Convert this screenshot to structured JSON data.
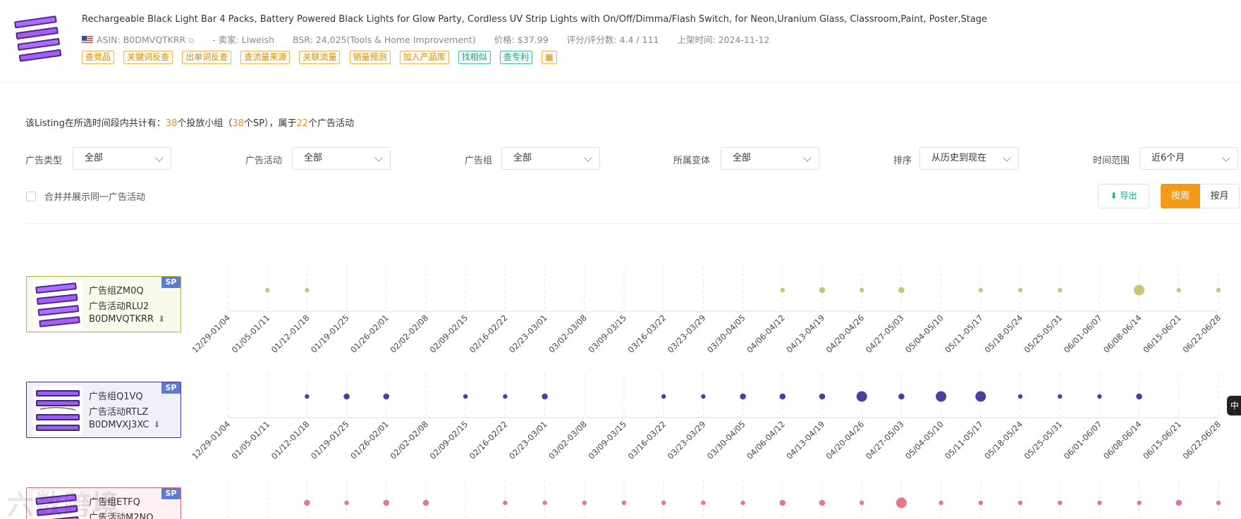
{
  "product": {
    "title": "Rechargeable Black Light Bar 4 Packs, Battery Powered Black Lights for Glow Party, Cordless UV Strip Lights with On/Off/Dimma/Flash Switch, for Neon,Uranium Glass, Classroom,Paint, Poster,Stage",
    "asin": "ASIN: B0DMVQTKRR",
    "seller": "- 卖家: Liweish",
    "bsr": "BSR: 24,025(Tools & Home Improvement)",
    "price": "价格: $37.99",
    "rating": "评分/评分数: 4.4 / 111",
    "listed": "上架时间: 2024-11-12",
    "tags": [
      "查竞品",
      "关键词反查",
      "出单词反查",
      "查流量来源",
      "关联流量",
      "销量预测",
      "加入产品库",
      "找相似",
      "查专利"
    ]
  },
  "summary": {
    "prefix": "该Listing在所选时间段内共计有：",
    "groups": "38",
    "mid1": "个投放小组（",
    "sp": "38",
    "mid2": "个SP），属于",
    "campaigns": "22",
    "suffix": "个广告活动"
  },
  "filters": {
    "ad_type": {
      "label": "广告类型",
      "value": "全部"
    },
    "campaign": {
      "label": "广告活动",
      "value": "全部"
    },
    "ad_group": {
      "label": "广告组",
      "value": "全部"
    },
    "variant": {
      "label": "所属变体",
      "value": "全部"
    },
    "sort": {
      "label": "排序",
      "value": "从历史到现在"
    },
    "time_range": {
      "label": "时间范围",
      "value": "近6个月"
    }
  },
  "merge_label": "合并并展示同一广告活动",
  "export_label": "导出",
  "granularity": {
    "week": "按周",
    "month": "按月"
  },
  "weeks": [
    "12/29-01/04",
    "01/05-01/11",
    "01/12-01/18",
    "01/19-01/25",
    "01/26-02/01",
    "02/02-02/08",
    "02/09-02/15",
    "02/16-02/22",
    "02/23-03/01",
    "03/02-03/08",
    "03/09-03/15",
    "03/16-03/22",
    "03/23-03/29",
    "03/30-04/05",
    "04/06-04/12",
    "04/13-04/19",
    "04/20-04/26",
    "04/27-05/03",
    "05/04-05/10",
    "05/11-05/17",
    "05/18-05/24",
    "05/25-05/31",
    "06/01-06/07",
    "06/08-06/14",
    "06/15-06/21",
    "06/22-06/28"
  ],
  "ad_groups": [
    {
      "group": "广告组ZM0Q",
      "campaign": "广告活动RLU2",
      "asin": "B0DMVQTKRR",
      "badge": "SP",
      "color": "#c5c774",
      "border": "#a8b452",
      "bg": "#f8faec",
      "dots": [
        0,
        1,
        1,
        0,
        0,
        0,
        0,
        0,
        0,
        0,
        0,
        0,
        0,
        0,
        1,
        2,
        1,
        2,
        0,
        1,
        1,
        1,
        0,
        3,
        1,
        1
      ]
    },
    {
      "group": "广告组Q1VQ",
      "campaign": "广告活动RTLZ",
      "asin": "B0DMVXJ3XC",
      "badge": "SP",
      "color": "#4b3f9e",
      "border": "#3b3488",
      "bg": "#f1f0fa",
      "dots": [
        0,
        0,
        1,
        2,
        2,
        0,
        1,
        1,
        2,
        0,
        0,
        1,
        1,
        2,
        2,
        2,
        3,
        2,
        3,
        3,
        1,
        1,
        1,
        2,
        0,
        0
      ]
    },
    {
      "group": "广告组ETFQ",
      "campaign": "广告活动M2NQ",
      "asin": "",
      "badge": "SP",
      "color": "#e07a86",
      "border": "#d76d7a",
      "bg": "#fdf1f3",
      "dots": [
        0,
        0,
        2,
        1,
        2,
        2,
        0,
        1,
        1,
        1,
        1,
        1,
        1,
        1,
        2,
        2,
        1,
        3,
        1,
        1,
        1,
        1,
        1,
        1,
        2,
        1
      ]
    }
  ],
  "lang_tab": "中",
  "watermark": "六数跨境"
}
